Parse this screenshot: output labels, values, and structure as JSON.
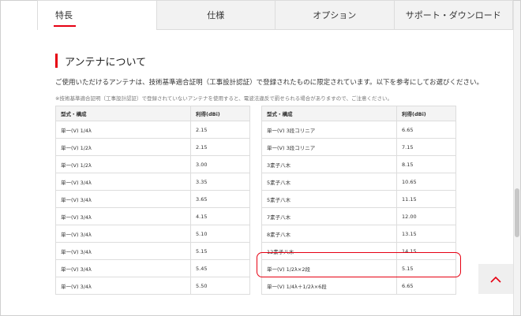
{
  "tabs": [
    "特長",
    "仕様",
    "オプション",
    "サポート・ダウンロード"
  ],
  "section": {
    "title": "アンテナについて",
    "description": "ご使用いただけるアンテナは、技術基準適合証明（工事設計認証）で登録されたものに限定されています。以下を参考にしてお選びください。",
    "note": "※技術基準適合証明（工事設計認証）で登録されていないアンテナを使用すると、電波法違反で罰せられる場合がありますので、ご注意ください。"
  },
  "table_left": {
    "headers": [
      "型式・構成",
      "利得(dBi)"
    ],
    "rows": [
      [
        "単一(V) 1/4λ",
        "2.15"
      ],
      [
        "単一(V) 1/2λ",
        "2.15"
      ],
      [
        "単一(V) 1/2λ",
        "3.00"
      ],
      [
        "単一(V) 3/4λ",
        "3.35"
      ],
      [
        "単一(V) 3/4λ",
        "3.65"
      ],
      [
        "単一(V) 3/4λ",
        "4.15"
      ],
      [
        "単一(V) 3/4λ",
        "5.10"
      ],
      [
        "単一(V) 3/4λ",
        "5.15"
      ],
      [
        "単一(V) 3/4λ",
        "5.45"
      ],
      [
        "単一(V) 3/4λ",
        "5.50"
      ]
    ]
  },
  "table_right": {
    "headers": [
      "型式・構成",
      "利得(dBi)"
    ],
    "rows": [
      [
        "単一(V) 3段コリニア",
        "6.65"
      ],
      [
        "単一(V) 3段コリニア",
        "7.15"
      ],
      [
        "3素子八木",
        "8.15"
      ],
      [
        "5素子八木",
        "10.65"
      ],
      [
        "5素子八木",
        "11.15"
      ],
      [
        "7素子八木",
        "12.00"
      ],
      [
        "8素子八木",
        "13.15"
      ],
      [
        "12素子八木",
        "14.15"
      ],
      [
        "単一(V) 1/2λ×2段",
        "5.15"
      ],
      [
        "単一(V) 1/4λ＋1/2λ×6段",
        "6.65"
      ]
    ]
  },
  "colors": {
    "accent": "#e60012"
  },
  "icons": {
    "back_to_top": "chevron-up-icon"
  }
}
